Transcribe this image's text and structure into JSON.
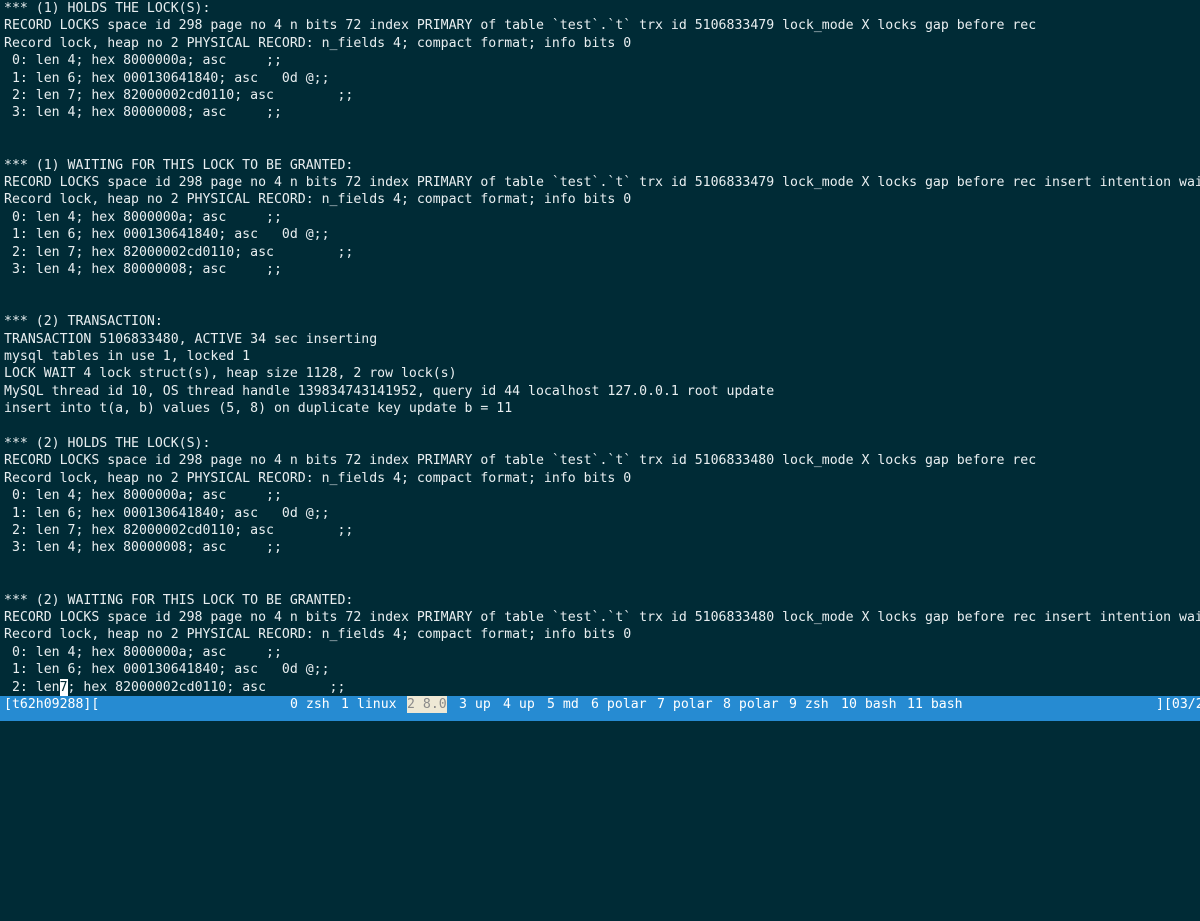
{
  "terminal": {
    "lines": [
      "*** (1) HOLDS THE LOCK(S):",
      "RECORD LOCKS space id 298 page no 4 n bits 72 index PRIMARY of table `test`.`t` trx id 5106833479 lock_mode X locks gap before rec",
      "Record lock, heap no 2 PHYSICAL RECORD: n_fields 4; compact format; info bits 0",
      " 0: len 4; hex 8000000a; asc     ;;",
      " 1: len 6; hex 000130641840; asc   0d @;;",
      " 2: len 7; hex 82000002cd0110; asc        ;;",
      " 3: len 4; hex 80000008; asc     ;;",
      "",
      "",
      "*** (1) WAITING FOR THIS LOCK TO BE GRANTED:",
      "RECORD LOCKS space id 298 page no 4 n bits 72 index PRIMARY of table `test`.`t` trx id 5106833479 lock_mode X locks gap before rec insert intention waiting",
      "Record lock, heap no 2 PHYSICAL RECORD: n_fields 4; compact format; info bits 0",
      " 0: len 4; hex 8000000a; asc     ;;",
      " 1: len 6; hex 000130641840; asc   0d @;;",
      " 2: len 7; hex 82000002cd0110; asc        ;;",
      " 3: len 4; hex 80000008; asc     ;;",
      "",
      "",
      "*** (2) TRANSACTION:",
      "TRANSACTION 5106833480, ACTIVE 34 sec inserting",
      "mysql tables in use 1, locked 1",
      "LOCK WAIT 4 lock struct(s), heap size 1128, 2 row lock(s)",
      "MySQL thread id 10, OS thread handle 139834743141952, query id 44 localhost 127.0.0.1 root update",
      "insert into t(a, b) values (5, 8) on duplicate key update b = 11",
      "",
      "*** (2) HOLDS THE LOCK(S):",
      "RECORD LOCKS space id 298 page no 4 n bits 72 index PRIMARY of table `test`.`t` trx id 5106833480 lock_mode X locks gap before rec",
      "Record lock, heap no 2 PHYSICAL RECORD: n_fields 4; compact format; info bits 0",
      " 0: len 4; hex 8000000a; asc     ;;",
      " 1: len 6; hex 000130641840; asc   0d @;;",
      " 2: len 7; hex 82000002cd0110; asc        ;;",
      " 3: len 4; hex 80000008; asc     ;;",
      "",
      "",
      "*** (2) WAITING FOR THIS LOCK TO BE GRANTED:",
      "RECORD LOCKS space id 298 page no 4 n bits 72 index PRIMARY of table `test`.`t` trx id 5106833480 lock_mode X locks gap before rec insert intention waiting",
      "Record lock, heap no 2 PHYSICAL RECORD: n_fields 4; compact format; info bits 0",
      " 0: len 4; hex 8000000a; asc     ;;",
      " 1: len 6; hex 000130641840; asc   0d @;;"
    ],
    "cursor_line": {
      "before": " 2: len",
      "cursor": "7",
      "after": "; hex 82000002cd0110; asc        ;;"
    }
  },
  "status_bar": {
    "session": "[t62h09288][",
    "windows": [
      {
        "label": "0 zsh",
        "active": false
      },
      {
        "label": "1 linux",
        "active": false
      },
      {
        "label": "2 8.0",
        "active": true
      },
      {
        "label": "3 up",
        "active": false
      },
      {
        "label": "4 up",
        "active": false
      },
      {
        "label": "5 md",
        "active": false
      },
      {
        "label": "6 polar",
        "active": false
      },
      {
        "label": "7 polar",
        "active": false
      },
      {
        "label": "8 polar",
        "active": false
      },
      {
        "label": "9 zsh",
        "active": false
      },
      {
        "label": "10 bash",
        "active": false
      },
      {
        "label": "11 bash",
        "active": false
      }
    ],
    "right": "][03/2"
  },
  "colors": {
    "background": "#002b36",
    "text": "#e8eef0",
    "status_bar": "#268bd2",
    "active_window": "#eee8d5"
  }
}
